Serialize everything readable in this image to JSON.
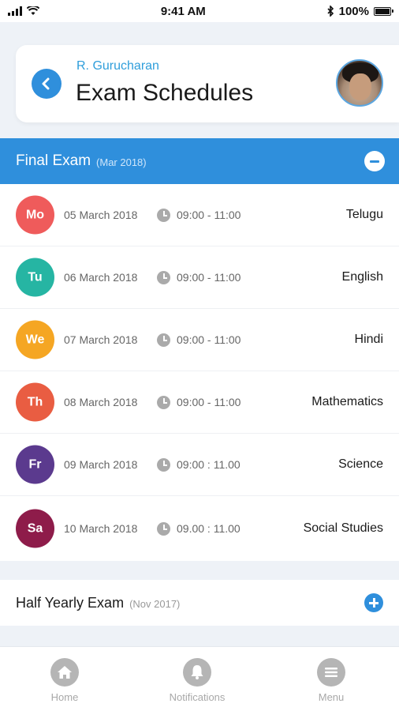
{
  "status_bar": {
    "time": "9:41 AM",
    "battery": "100%",
    "icons": [
      "signal-icon",
      "wifi-icon",
      "bluetooth-icon",
      "battery-icon"
    ]
  },
  "header": {
    "subtitle": "R. Gurucharan",
    "title": "Exam Schedules",
    "back_icon": "chevron-left-icon"
  },
  "final_exam": {
    "title": "Final Exam",
    "date": "(Mar 2018)",
    "toggle_icon": "minus-circle-icon",
    "rows": [
      {
        "day": "Mo",
        "color": "#ef5b5b",
        "date": "05 March 2018",
        "time": "09:00 - 11:00",
        "subject": "Telugu"
      },
      {
        "day": "Tu",
        "color": "#26b5a3",
        "date": "06 March 2018",
        "time": "09:00 - 11:00",
        "subject": "English"
      },
      {
        "day": "We",
        "color": "#f5a623",
        "date": "07 March 2018",
        "time": "09:00 - 11:00",
        "subject": "Hindi"
      },
      {
        "day": "Th",
        "color": "#e95d42",
        "date": "08 March 2018",
        "time": "09:00 - 11:00",
        "subject": "Mathematics"
      },
      {
        "day": "Fr",
        "color": "#5b3a8e",
        "date": "09 March 2018",
        "time": "09:00 : 11.00",
        "subject": "Science"
      },
      {
        "day": "Sa",
        "color": "#8e1c4a",
        "date": "10 March 2018",
        "time": "09.00 : 11.00",
        "subject": "Social Studies"
      }
    ]
  },
  "half_yearly": {
    "title": "Half Yearly Exam",
    "date": "(Nov 2017)",
    "toggle_icon": "plus-circle-icon"
  },
  "bottom_nav": {
    "items": [
      {
        "label": "Home",
        "icon": "home-icon"
      },
      {
        "label": "Notifications",
        "icon": "bell-icon"
      },
      {
        "label": "Menu",
        "icon": "menu-icon"
      }
    ]
  },
  "colors": {
    "accent": "#2f8fdc",
    "background": "#eef2f7"
  }
}
